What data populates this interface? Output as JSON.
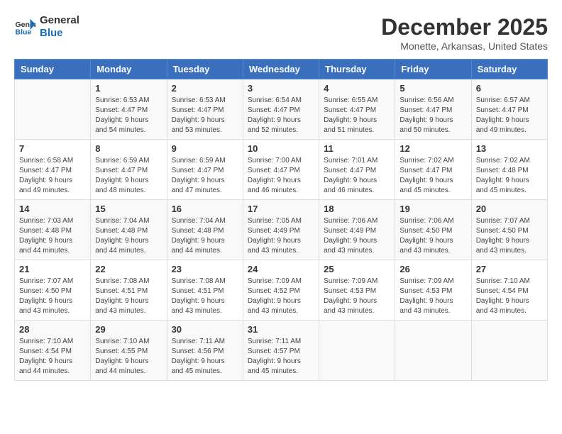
{
  "logo": {
    "line1": "General",
    "line2": "Blue"
  },
  "title": "December 2025",
  "location": "Monette, Arkansas, United States",
  "days_header": [
    "Sunday",
    "Monday",
    "Tuesday",
    "Wednesday",
    "Thursday",
    "Friday",
    "Saturday"
  ],
  "weeks": [
    [
      {
        "day": "",
        "sunrise": "",
        "sunset": "",
        "daylight": ""
      },
      {
        "day": "1",
        "sunrise": "Sunrise: 6:53 AM",
        "sunset": "Sunset: 4:47 PM",
        "daylight": "Daylight: 9 hours and 54 minutes."
      },
      {
        "day": "2",
        "sunrise": "Sunrise: 6:53 AM",
        "sunset": "Sunset: 4:47 PM",
        "daylight": "Daylight: 9 hours and 53 minutes."
      },
      {
        "day": "3",
        "sunrise": "Sunrise: 6:54 AM",
        "sunset": "Sunset: 4:47 PM",
        "daylight": "Daylight: 9 hours and 52 minutes."
      },
      {
        "day": "4",
        "sunrise": "Sunrise: 6:55 AM",
        "sunset": "Sunset: 4:47 PM",
        "daylight": "Daylight: 9 hours and 51 minutes."
      },
      {
        "day": "5",
        "sunrise": "Sunrise: 6:56 AM",
        "sunset": "Sunset: 4:47 PM",
        "daylight": "Daylight: 9 hours and 50 minutes."
      },
      {
        "day": "6",
        "sunrise": "Sunrise: 6:57 AM",
        "sunset": "Sunset: 4:47 PM",
        "daylight": "Daylight: 9 hours and 49 minutes."
      }
    ],
    [
      {
        "day": "7",
        "sunrise": "Sunrise: 6:58 AM",
        "sunset": "Sunset: 4:47 PM",
        "daylight": "Daylight: 9 hours and 49 minutes."
      },
      {
        "day": "8",
        "sunrise": "Sunrise: 6:59 AM",
        "sunset": "Sunset: 4:47 PM",
        "daylight": "Daylight: 9 hours and 48 minutes."
      },
      {
        "day": "9",
        "sunrise": "Sunrise: 6:59 AM",
        "sunset": "Sunset: 4:47 PM",
        "daylight": "Daylight: 9 hours and 47 minutes."
      },
      {
        "day": "10",
        "sunrise": "Sunrise: 7:00 AM",
        "sunset": "Sunset: 4:47 PM",
        "daylight": "Daylight: 9 hours and 46 minutes."
      },
      {
        "day": "11",
        "sunrise": "Sunrise: 7:01 AM",
        "sunset": "Sunset: 4:47 PM",
        "daylight": "Daylight: 9 hours and 46 minutes."
      },
      {
        "day": "12",
        "sunrise": "Sunrise: 7:02 AM",
        "sunset": "Sunset: 4:47 PM",
        "daylight": "Daylight: 9 hours and 45 minutes."
      },
      {
        "day": "13",
        "sunrise": "Sunrise: 7:02 AM",
        "sunset": "Sunset: 4:48 PM",
        "daylight": "Daylight: 9 hours and 45 minutes."
      }
    ],
    [
      {
        "day": "14",
        "sunrise": "Sunrise: 7:03 AM",
        "sunset": "Sunset: 4:48 PM",
        "daylight": "Daylight: 9 hours and 44 minutes."
      },
      {
        "day": "15",
        "sunrise": "Sunrise: 7:04 AM",
        "sunset": "Sunset: 4:48 PM",
        "daylight": "Daylight: 9 hours and 44 minutes."
      },
      {
        "day": "16",
        "sunrise": "Sunrise: 7:04 AM",
        "sunset": "Sunset: 4:48 PM",
        "daylight": "Daylight: 9 hours and 44 minutes."
      },
      {
        "day": "17",
        "sunrise": "Sunrise: 7:05 AM",
        "sunset": "Sunset: 4:49 PM",
        "daylight": "Daylight: 9 hours and 43 minutes."
      },
      {
        "day": "18",
        "sunrise": "Sunrise: 7:06 AM",
        "sunset": "Sunset: 4:49 PM",
        "daylight": "Daylight: 9 hours and 43 minutes."
      },
      {
        "day": "19",
        "sunrise": "Sunrise: 7:06 AM",
        "sunset": "Sunset: 4:50 PM",
        "daylight": "Daylight: 9 hours and 43 minutes."
      },
      {
        "day": "20",
        "sunrise": "Sunrise: 7:07 AM",
        "sunset": "Sunset: 4:50 PM",
        "daylight": "Daylight: 9 hours and 43 minutes."
      }
    ],
    [
      {
        "day": "21",
        "sunrise": "Sunrise: 7:07 AM",
        "sunset": "Sunset: 4:50 PM",
        "daylight": "Daylight: 9 hours and 43 minutes."
      },
      {
        "day": "22",
        "sunrise": "Sunrise: 7:08 AM",
        "sunset": "Sunset: 4:51 PM",
        "daylight": "Daylight: 9 hours and 43 minutes."
      },
      {
        "day": "23",
        "sunrise": "Sunrise: 7:08 AM",
        "sunset": "Sunset: 4:51 PM",
        "daylight": "Daylight: 9 hours and 43 minutes."
      },
      {
        "day": "24",
        "sunrise": "Sunrise: 7:09 AM",
        "sunset": "Sunset: 4:52 PM",
        "daylight": "Daylight: 9 hours and 43 minutes."
      },
      {
        "day": "25",
        "sunrise": "Sunrise: 7:09 AM",
        "sunset": "Sunset: 4:53 PM",
        "daylight": "Daylight: 9 hours and 43 minutes."
      },
      {
        "day": "26",
        "sunrise": "Sunrise: 7:09 AM",
        "sunset": "Sunset: 4:53 PM",
        "daylight": "Daylight: 9 hours and 43 minutes."
      },
      {
        "day": "27",
        "sunrise": "Sunrise: 7:10 AM",
        "sunset": "Sunset: 4:54 PM",
        "daylight": "Daylight: 9 hours and 43 minutes."
      }
    ],
    [
      {
        "day": "28",
        "sunrise": "Sunrise: 7:10 AM",
        "sunset": "Sunset: 4:54 PM",
        "daylight": "Daylight: 9 hours and 44 minutes."
      },
      {
        "day": "29",
        "sunrise": "Sunrise: 7:10 AM",
        "sunset": "Sunset: 4:55 PM",
        "daylight": "Daylight: 9 hours and 44 minutes."
      },
      {
        "day": "30",
        "sunrise": "Sunrise: 7:11 AM",
        "sunset": "Sunset: 4:56 PM",
        "daylight": "Daylight: 9 hours and 45 minutes."
      },
      {
        "day": "31",
        "sunrise": "Sunrise: 7:11 AM",
        "sunset": "Sunset: 4:57 PM",
        "daylight": "Daylight: 9 hours and 45 minutes."
      },
      {
        "day": "",
        "sunrise": "",
        "sunset": "",
        "daylight": ""
      },
      {
        "day": "",
        "sunrise": "",
        "sunset": "",
        "daylight": ""
      },
      {
        "day": "",
        "sunrise": "",
        "sunset": "",
        "daylight": ""
      }
    ]
  ]
}
